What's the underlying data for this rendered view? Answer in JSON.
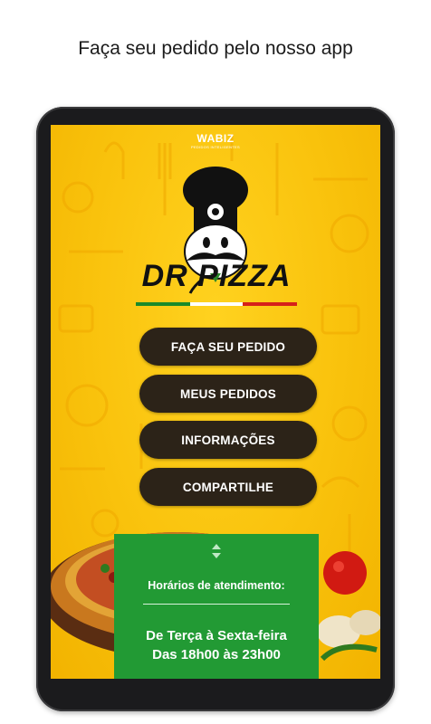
{
  "headline": "Faça seu pedido pelo nosso app",
  "brand": {
    "name": "WABIZ",
    "tagline": "PEDIDOS INTELIGENTES"
  },
  "logo": {
    "text": "DR PIZZA"
  },
  "menu": [
    {
      "label": "FAÇA SEU PEDIDO"
    },
    {
      "label": "MEUS PEDIDOS"
    },
    {
      "label": "INFORMAÇÕES"
    },
    {
      "label": "COMPARTILHE"
    }
  ],
  "hours": {
    "title": "Horários de atendimento:",
    "days": "De Terça à Sexta-feira",
    "time": "Das 18h00 às 23h00",
    "icon": "up-down-arrows-icon"
  },
  "colors": {
    "background": "#f9c20c",
    "button": "#2c2318",
    "hours_card": "#229a34"
  }
}
